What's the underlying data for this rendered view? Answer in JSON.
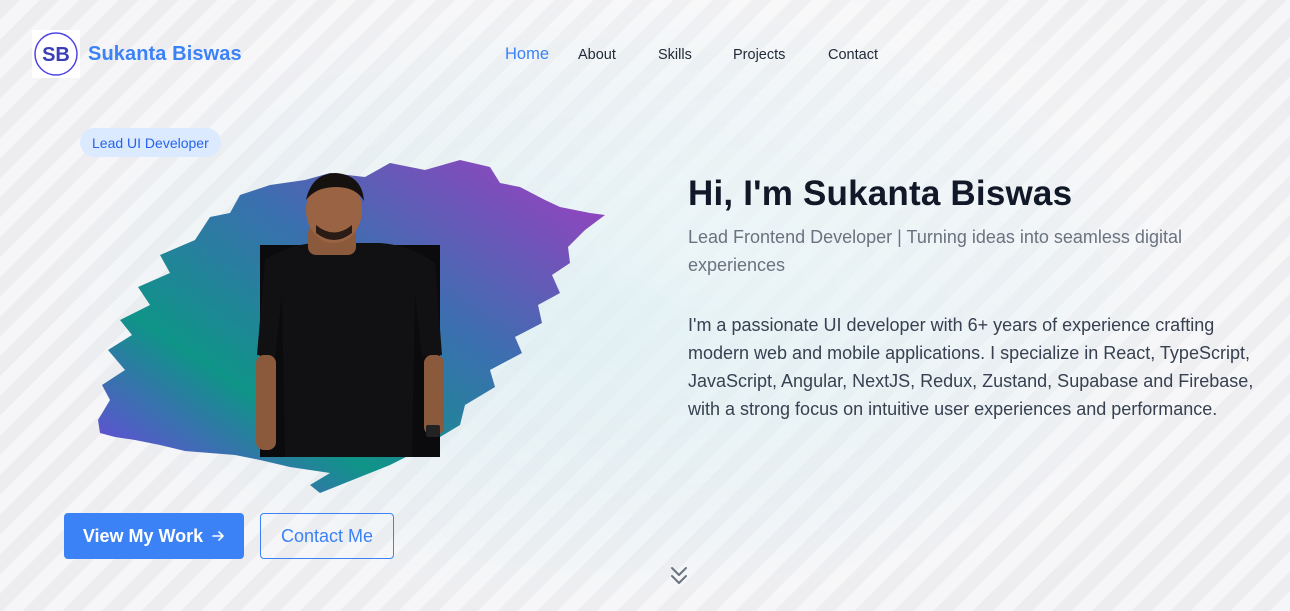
{
  "brand": {
    "logo_initials": "SB",
    "name": "Sukanta Biswas"
  },
  "nav": {
    "items": [
      {
        "label": "Home",
        "active": true
      },
      {
        "label": "About",
        "active": false
      },
      {
        "label": "Skills",
        "active": false
      },
      {
        "label": "Projects",
        "active": false
      },
      {
        "label": "Contact",
        "active": false
      }
    ]
  },
  "hero": {
    "badge": "Lead UI Developer",
    "title": "Hi, I'm Sukanta Biswas",
    "subtitle": "Lead Frontend Developer | Turning ideas into seamless digital experiences",
    "description": "I'm a passionate UI developer with 6+ years of experience crafting modern web and mobile applications. I specialize in React, TypeScript, JavaScript, Angular, NextJS, Redux, Zustand, Supabase and Firebase, with a strong focus on intuitive user experiences and performance."
  },
  "buttons": {
    "primary": "View My Work",
    "secondary": "Contact Me"
  },
  "icons": {
    "primary_button_icon": "arrow-right-icon",
    "scroll": "chevrons-down-icon"
  },
  "colors": {
    "accent": "#3b82f6",
    "badge_bg": "#dbeafe",
    "brush_start": "#0d9488",
    "brush_end": "#9333ea"
  }
}
